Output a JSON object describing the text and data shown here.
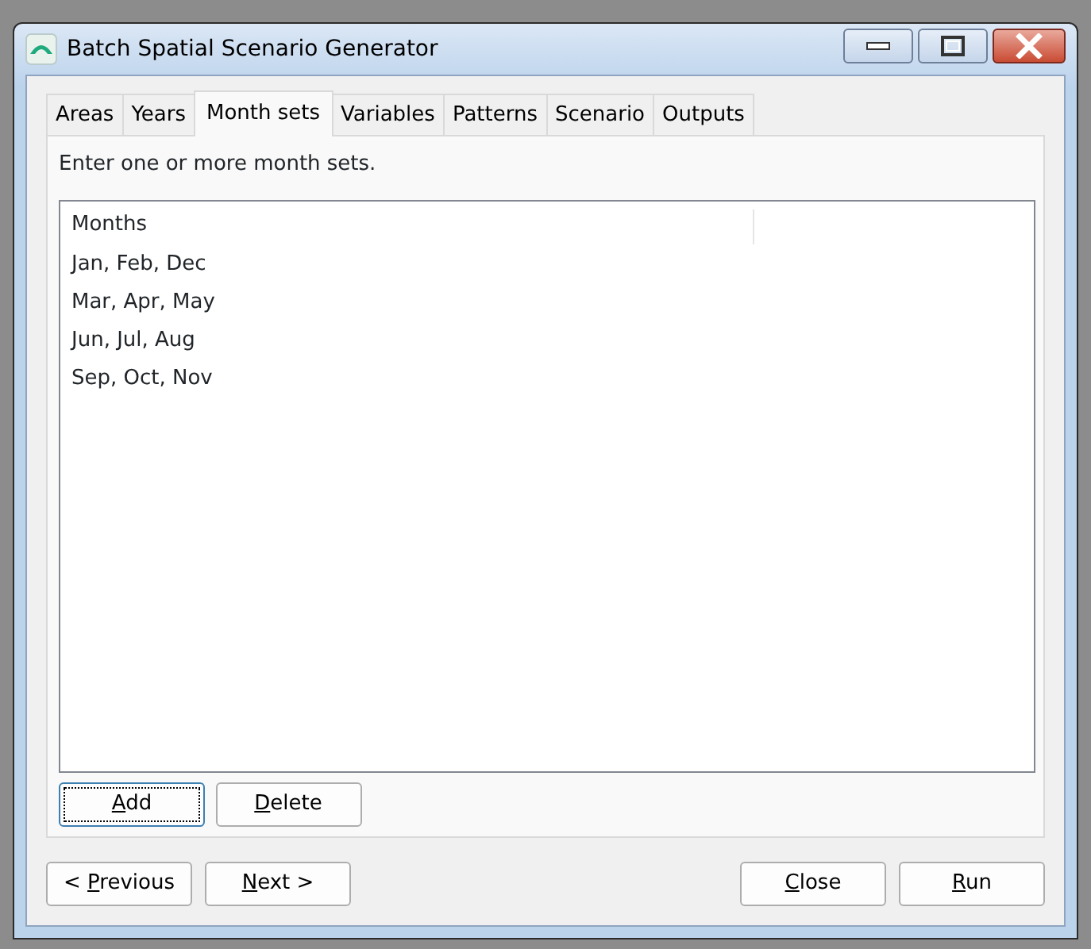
{
  "window": {
    "title": "Batch Spatial Scenario Generator"
  },
  "tabs": [
    {
      "label": "Areas",
      "selected": false
    },
    {
      "label": "Years",
      "selected": false
    },
    {
      "label": "Month sets",
      "selected": true
    },
    {
      "label": "Variables",
      "selected": false
    },
    {
      "label": "Patterns",
      "selected": false
    },
    {
      "label": "Scenario",
      "selected": false
    },
    {
      "label": "Outputs",
      "selected": false
    }
  ],
  "instruction": "Enter one or more month sets.",
  "list": {
    "columns": [
      "Months"
    ],
    "rows": [
      "Jan, Feb, Dec",
      "Mar, Apr, May",
      "Jun, Jul, Aug",
      "Sep, Oct, Nov"
    ]
  },
  "panel_buttons": [
    {
      "access_key": "A",
      "label_end": "dd",
      "focused": true
    },
    {
      "access_key": "D",
      "label_end": "elete",
      "focused": false
    }
  ],
  "nav_buttons": [
    {
      "label_start": "< ",
      "access_key": "P",
      "label_end": "revious"
    },
    {
      "access_key": "N",
      "label_end": "ext >"
    }
  ],
  "action_buttons": [
    {
      "access_key": "C",
      "label_end": "lose"
    },
    {
      "access_key": "R",
      "label_end": "un"
    }
  ]
}
